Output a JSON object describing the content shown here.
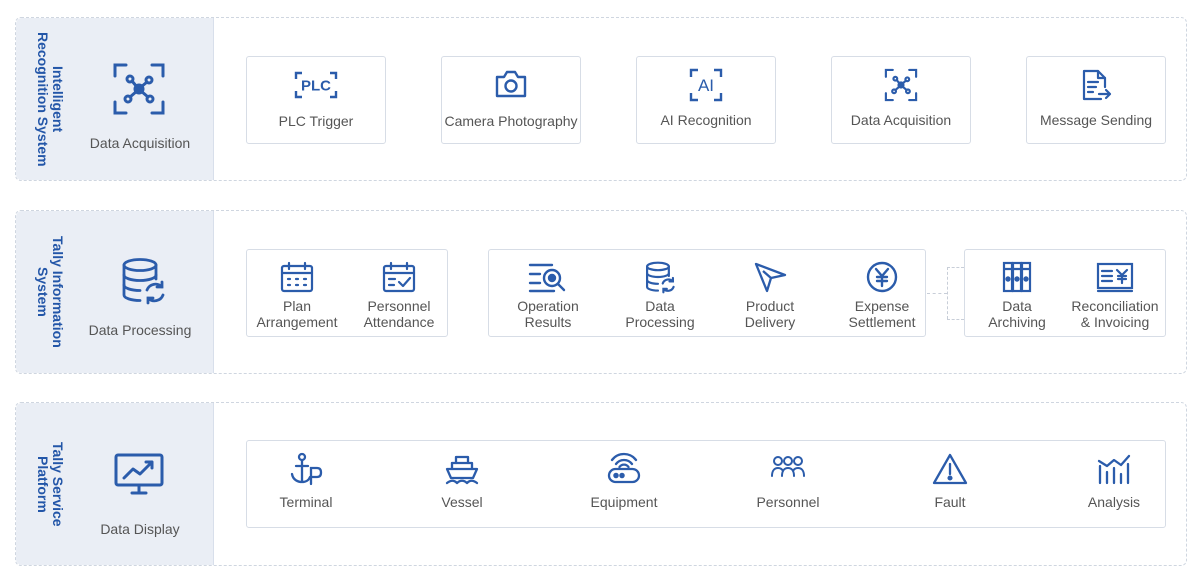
{
  "sections": [
    {
      "title": "Intelligent\nRecognition System",
      "side_label": "Data Acquisition",
      "side_icon": "scan-network-icon",
      "items": [
        {
          "label": "PLC Trigger",
          "icon": "plc-icon"
        },
        {
          "label": "Camera Photography",
          "icon": "camera-icon"
        },
        {
          "label": "AI Recognition",
          "icon": "ai-icon"
        },
        {
          "label": "Data Acquisition",
          "icon": "scan-network-icon"
        },
        {
          "label": "Message Sending",
          "icon": "document-send-icon"
        }
      ]
    },
    {
      "title": "Tally Information\nSystem",
      "side_label": "Data Processing",
      "side_icon": "database-sync-icon",
      "items": [
        {
          "label": "Plan\nArrangement",
          "icon": "calendar-grid-icon"
        },
        {
          "label": "Personnel\nAttendance",
          "icon": "calendar-check-icon"
        },
        {
          "label": "Operation\nResults",
          "icon": "list-search-icon"
        },
        {
          "label": "Data\nProcessing",
          "icon": "database-sync-icon"
        },
        {
          "label": "Product\nDelivery",
          "icon": "paper-plane-icon"
        },
        {
          "label": "Expense\nSettlement",
          "icon": "yen-circle-icon"
        },
        {
          "label": "Data\nArchiving",
          "icon": "binders-icon"
        },
        {
          "label": "Reconciliation\n& Invoicing",
          "icon": "invoice-yen-icon"
        }
      ]
    },
    {
      "title": "Tally Service\nPlatform",
      "side_label": "Data Display",
      "side_icon": "monitor-chart-icon",
      "items": [
        {
          "label": "Terminal",
          "icon": "anchor-p-icon"
        },
        {
          "label": "Vessel",
          "icon": "ship-icon"
        },
        {
          "label": "Equipment",
          "icon": "router-icon"
        },
        {
          "label": "Personnel",
          "icon": "people-icon"
        },
        {
          "label": "Fault",
          "icon": "warning-icon"
        },
        {
          "label": "Analysis",
          "icon": "bar-trend-icon"
        }
      ]
    }
  ],
  "accent_color": "#2b5cab",
  "title_color": "#2356a8",
  "sidebar_bg": "#eaeef5"
}
